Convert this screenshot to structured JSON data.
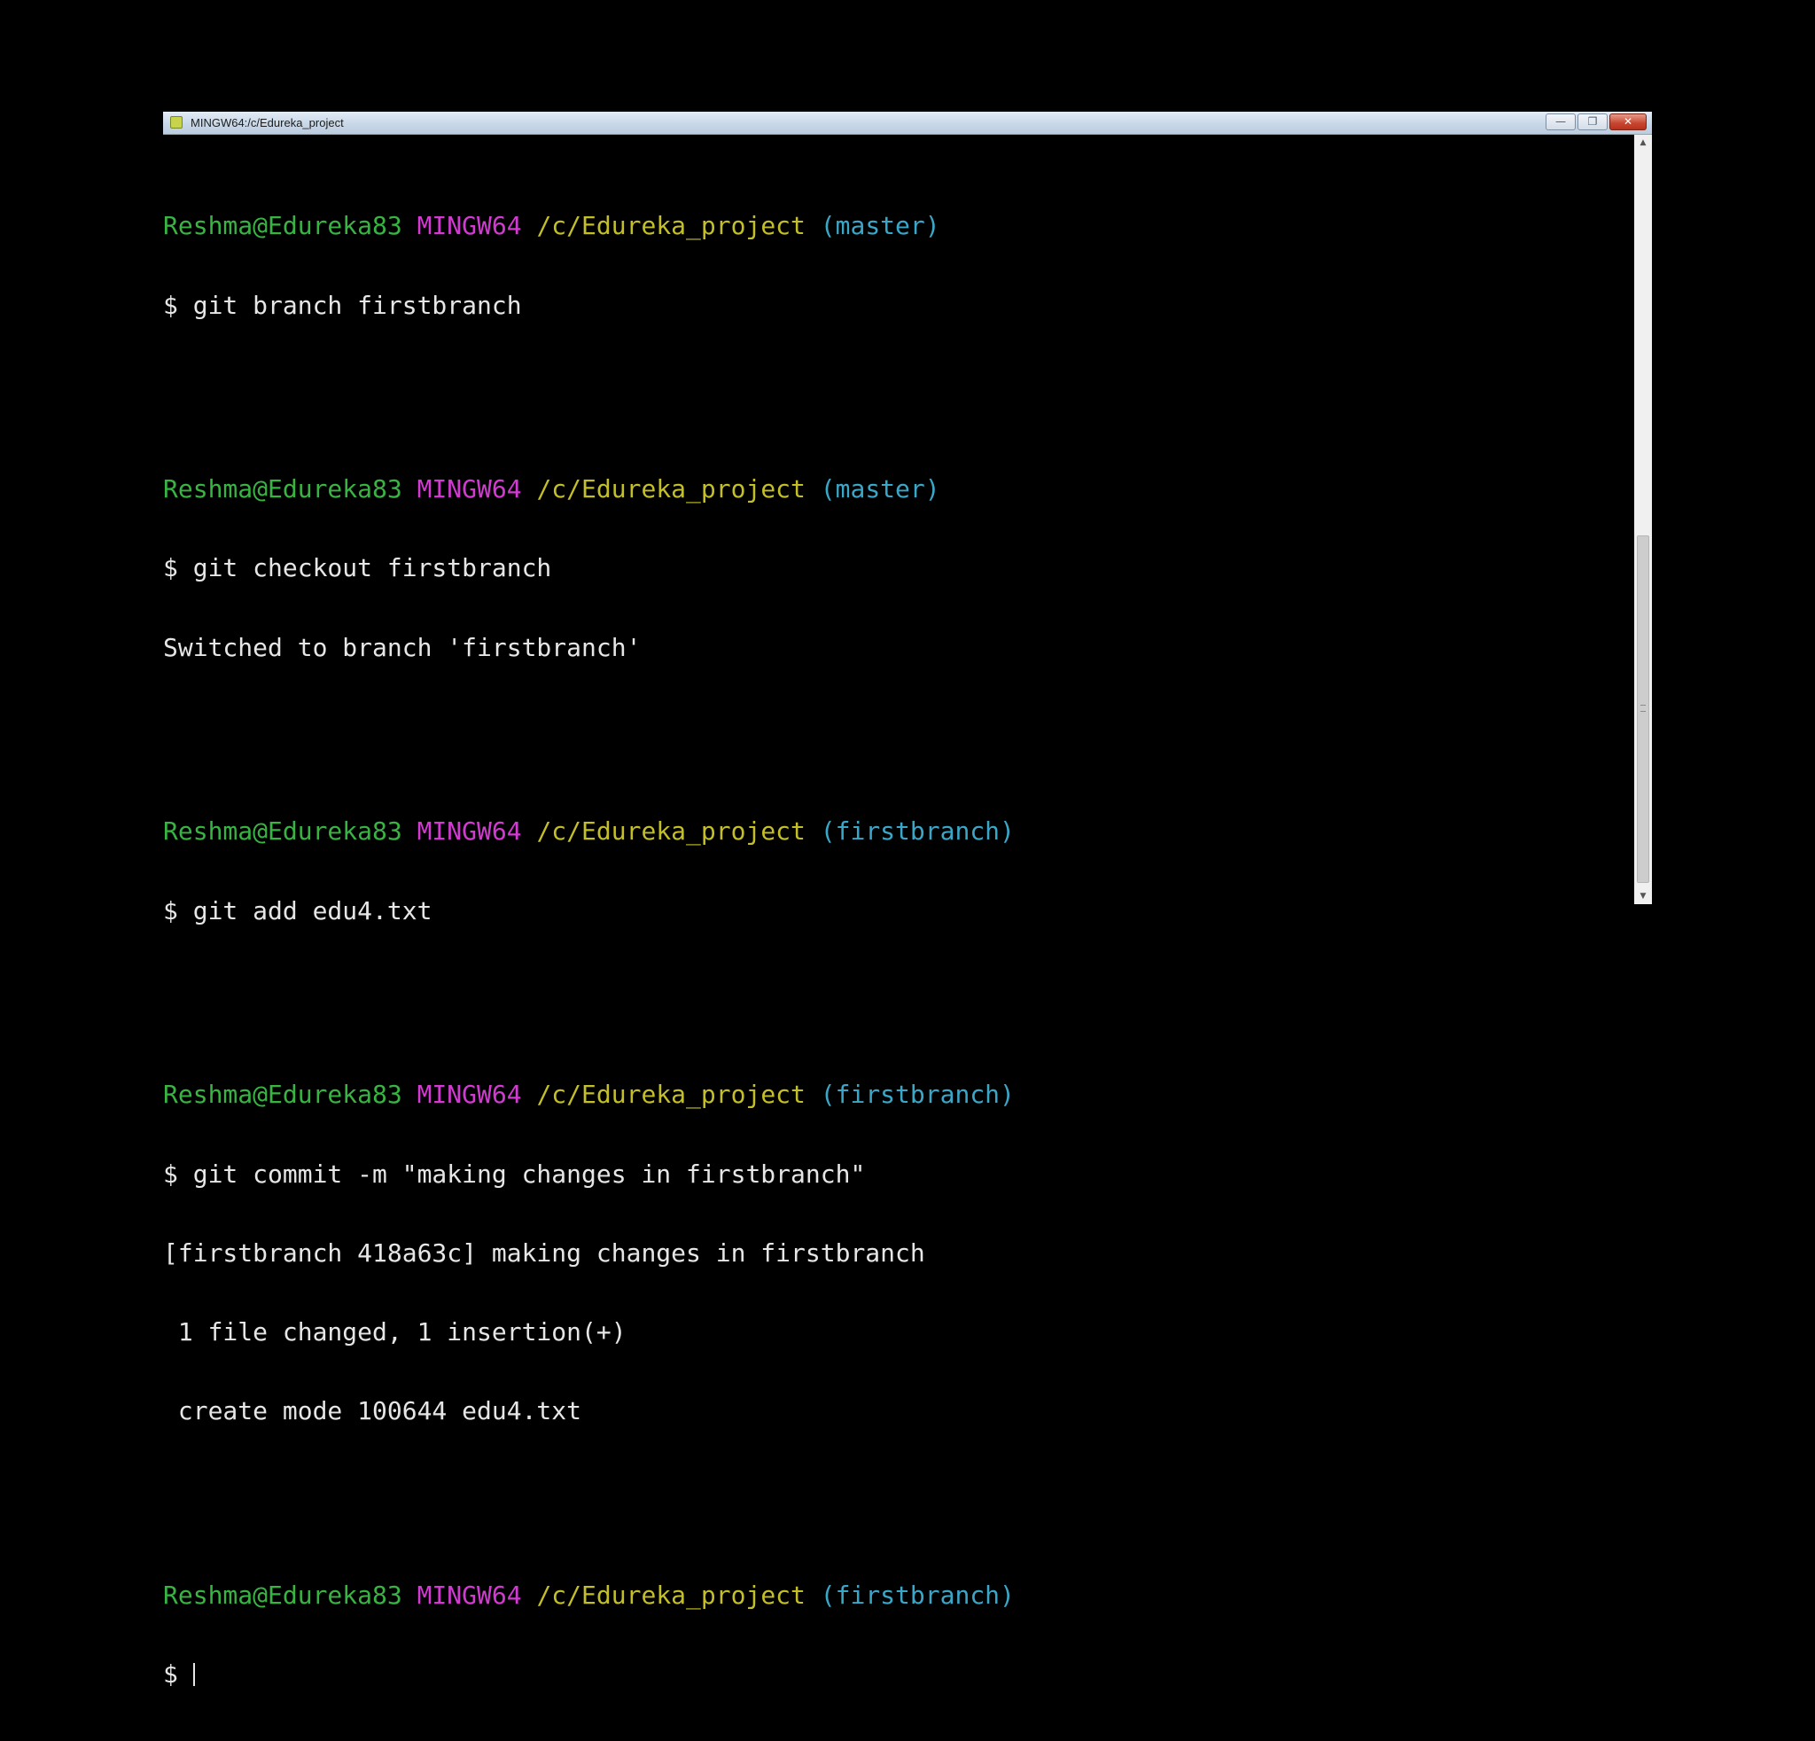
{
  "window": {
    "title": "MINGW64:/c/Edureka_project",
    "minimize_glyph": "—",
    "maximize_glyph": "❐",
    "close_glyph": "✕"
  },
  "colors": {
    "user": "#38b443",
    "system": "#d23ad2",
    "path": "#c4bf27",
    "branch": "#3aa7c8",
    "text": "#e6e6e6",
    "background": "#000000"
  },
  "prompts": [
    {
      "user": "Reshma@Edureka83",
      "system": "MINGW64",
      "path": "/c/Edureka_project",
      "branch": "(master)"
    },
    {
      "user": "Reshma@Edureka83",
      "system": "MINGW64",
      "path": "/c/Edureka_project",
      "branch": "(master)"
    },
    {
      "user": "Reshma@Edureka83",
      "system": "MINGW64",
      "path": "/c/Edureka_project",
      "branch": "(firstbranch)"
    },
    {
      "user": "Reshma@Edureka83",
      "system": "MINGW64",
      "path": "/c/Edureka_project",
      "branch": "(firstbranch)"
    },
    {
      "user": "Reshma@Edureka83",
      "system": "MINGW64",
      "path": "/c/Edureka_project",
      "branch": "(firstbranch)"
    }
  ],
  "commands": [
    "$ git branch firstbranch",
    "$ git checkout firstbranch",
    "$ git add edu4.txt",
    "$ git commit -m \"making changes in firstbranch\"",
    "$ "
  ],
  "outputs": {
    "checkout": [
      "Switched to branch 'firstbranch'"
    ],
    "commit": [
      "[firstbranch 418a63c] making changes in firstbranch",
      " 1 file changed, 1 insertion(+)",
      " create mode 100644 edu4.txt"
    ]
  },
  "scrollbar": {
    "up_glyph": "▲",
    "down_glyph": "▼"
  }
}
